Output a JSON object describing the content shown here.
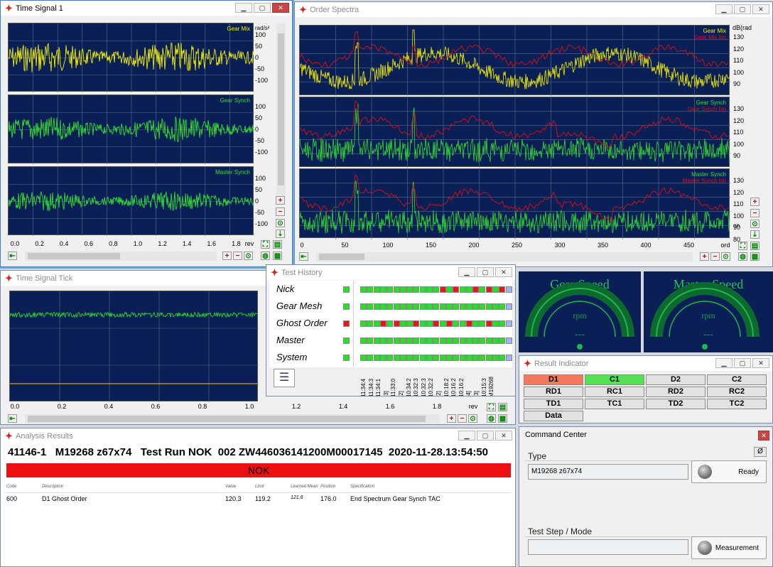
{
  "colors": {
    "plot_bg": "#0a1f56",
    "grid": "#5b6b93",
    "yellow": "#f4f000",
    "green": "#30e030",
    "red": "#e01010",
    "nok": "#ec1010",
    "gauge_green": "#21c75a"
  },
  "time_signal": {
    "title": "Time Signal 1",
    "unit": "rad/s²",
    "x_unit": "rev",
    "channels": [
      {
        "name": "Gear Mix",
        "color": "yellow"
      },
      {
        "name": "Gear Synch",
        "color": "green"
      },
      {
        "name": "Master Synch",
        "color": "green"
      }
    ],
    "y_ticks": [
      "100",
      "50",
      "0",
      "-50",
      "-100"
    ],
    "x_ticks": [
      "0.0",
      "0.2",
      "0.4",
      "0.6",
      "0.8",
      "1.0",
      "1.2",
      "1.4",
      "1.6",
      "1.8"
    ]
  },
  "order_spectra": {
    "title": "Order Spectra",
    "unit": "dB(rad",
    "x_unit": "ord",
    "x_ticks": [
      "0",
      "50",
      "100",
      "150",
      "200",
      "250",
      "300",
      "350",
      "400",
      "450"
    ],
    "channels": [
      {
        "name": "Gear Mix",
        "limit_name": "Gear Mix lim",
        "y_ticks": [
          "130",
          "120",
          "110",
          "100",
          "90"
        ]
      },
      {
        "name": "Gear Synch",
        "limit_name": "Gear Synch lim",
        "y_ticks": [
          "130",
          "120",
          "110",
          "100",
          "90"
        ]
      },
      {
        "name": "Master Synch",
        "limit_name": "Master Synch lim",
        "y_ticks": [
          "130",
          "120",
          "110",
          "100",
          "90",
          "80"
        ]
      }
    ],
    "extra_label": "on"
  },
  "time_signal_tick": {
    "title": "Time Signal Tick",
    "x_unit": "rev",
    "x_ticks": [
      "0.0",
      "0.2",
      "0.4",
      "0.6",
      "0.8",
      "1.0",
      "1.2",
      "1.4",
      "1.6",
      "1.8"
    ]
  },
  "test_history": {
    "title": "Test History",
    "rows": [
      {
        "label": "Nick",
        "status": "green",
        "history": [
          "g",
          "g",
          "g",
          "g",
          "g",
          "g",
          "g",
          "g",
          "g",
          "g",
          "g",
          "g",
          "r",
          "g",
          "r",
          "g",
          "g",
          "r",
          "g",
          "r",
          "g",
          "r",
          "b"
        ]
      },
      {
        "label": "Gear Mesh",
        "status": "green",
        "history": [
          "g",
          "g",
          "g",
          "g",
          "g",
          "g",
          "g",
          "g",
          "g",
          "g",
          "g",
          "g",
          "g",
          "g",
          "g",
          "g",
          "g",
          "g",
          "g",
          "g",
          "g",
          "g",
          "b"
        ]
      },
      {
        "label": "Ghost Order",
        "status": "red",
        "history": [
          "g",
          "g",
          "g",
          "r",
          "g",
          "r",
          "g",
          "g",
          "r",
          "g",
          "g",
          "r",
          "g",
          "r",
          "g",
          "g",
          "r",
          "g",
          "g",
          "r",
          "g",
          "g",
          "b"
        ]
      },
      {
        "label": "Master",
        "status": "green",
        "history": [
          "g",
          "g",
          "g",
          "g",
          "g",
          "g",
          "g",
          "g",
          "g",
          "g",
          "g",
          "g",
          "g",
          "g",
          "g",
          "g",
          "g",
          "g",
          "g",
          "g",
          "g",
          "g",
          "b"
        ]
      },
      {
        "label": "System",
        "status": "green",
        "history": [
          "g",
          "g",
          "g",
          "g",
          "g",
          "g",
          "g",
          "g",
          "g",
          "g",
          "g",
          "g",
          "g",
          "g",
          "g",
          "g",
          "g",
          "g",
          "g",
          "g",
          "g",
          "g",
          "b"
        ]
      }
    ],
    "timestamps": [
      "11:34:4",
      "11:34:3",
      "11:34:1",
      "[3]",
      "11:33:0",
      "[2]",
      "10:34:2",
      "10:32:3",
      "10:32:3",
      "10:32:2",
      "[2]",
      "10:18:2",
      "10:16:2",
      "10:16:2",
      "[4]",
      "[3]",
      "10:15:3",
      "M19268"
    ]
  },
  "gauges": [
    {
      "title": "Gear Speed",
      "unit": "rpm",
      "value": "---"
    },
    {
      "title": "Master Speed",
      "unit": "rpm",
      "value": "---"
    }
  ],
  "result_indicator": {
    "title": "Result Indicator",
    "buttons": [
      {
        "label": "D1",
        "state": "red"
      },
      {
        "label": "C1",
        "state": "green"
      },
      {
        "label": "D2",
        "state": "none"
      },
      {
        "label": "C2",
        "state": "none"
      },
      {
        "label": "RD1",
        "state": "none"
      },
      {
        "label": "RC1",
        "state": "none"
      },
      {
        "label": "RD2",
        "state": "none"
      },
      {
        "label": "RC2",
        "state": "none"
      },
      {
        "label": "TD1",
        "state": "none"
      },
      {
        "label": "TC1",
        "state": "none"
      },
      {
        "label": "TD2",
        "state": "none"
      },
      {
        "label": "TC2",
        "state": "none"
      },
      {
        "label": "Data",
        "state": "none"
      }
    ]
  },
  "analysis_results": {
    "title": "Analysis Results",
    "header_line": "41146-1   M19268 z67x74   Test Run NOK  002 ZW446036141200M00017145  2020-11-28.13:54:50",
    "status": "NOK",
    "columns": [
      "Code",
      "Description",
      "Value",
      "Limit",
      "Learned Mean",
      "Position",
      "Specification"
    ],
    "rows": [
      [
        "600",
        "D1 Ghost Order",
        "120.3",
        "119.2",
        "121.6",
        "176.0",
        "End Spectrum Gear Synch TAC"
      ]
    ]
  },
  "command_center": {
    "title": "Command Center",
    "type_label": "Type",
    "type_value": "M19268 z67x74",
    "ready_label": "Ready",
    "step_label": "Test Step / Mode",
    "step_value": "",
    "measure_label": "Measurement",
    "clear_label": "Ø"
  }
}
